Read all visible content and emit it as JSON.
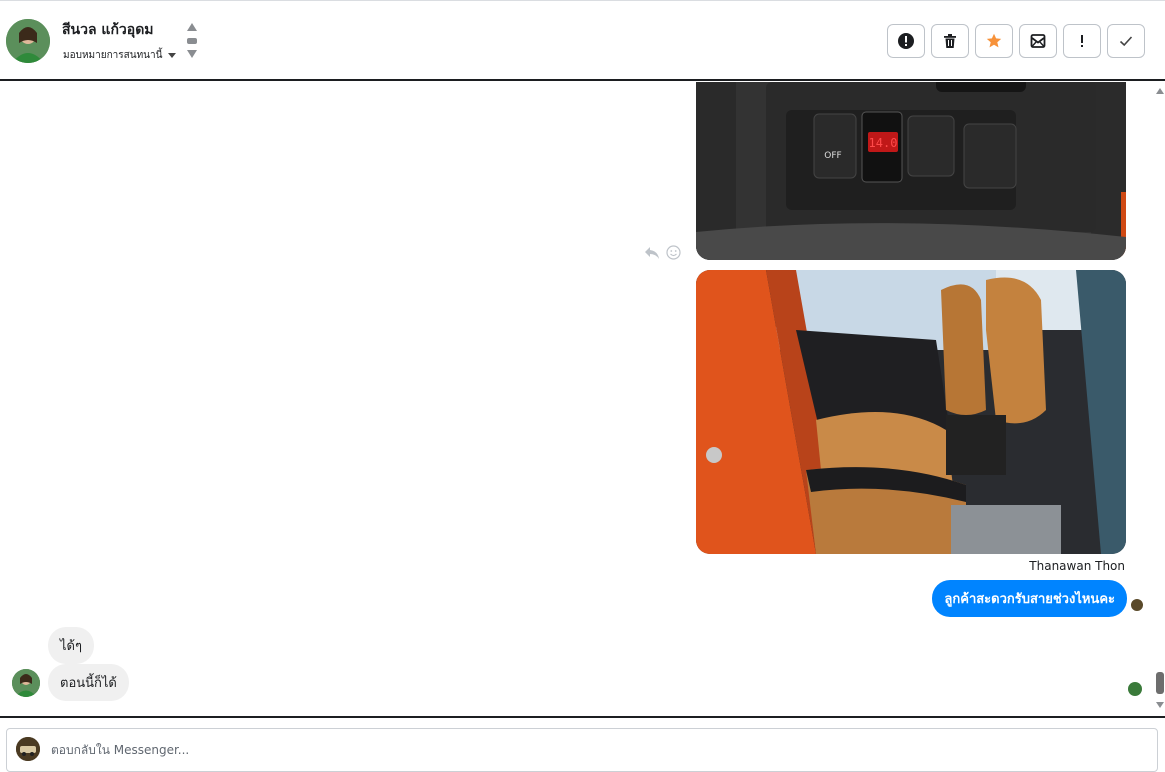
{
  "header": {
    "contact_name": "สีนวล แก้วอุดม",
    "assign_label": "มอบหมายการสนทนานี้",
    "actions": [
      {
        "icon": "alert-circle-icon",
        "label": "Report"
      },
      {
        "icon": "trash-icon",
        "label": "Delete"
      },
      {
        "icon": "star-icon",
        "label": "Star"
      },
      {
        "icon": "mark-unread-icon",
        "label": "Mark unread"
      },
      {
        "icon": "exclamation-icon",
        "label": "Follow up"
      },
      {
        "icon": "check-icon",
        "label": "Done"
      }
    ],
    "accent_star": "#f7923a"
  },
  "conversation": {
    "outgoing": {
      "sender_name": "Thanawan Thon",
      "text": "ลูกค้าสะดวกรับสายช่วงไหนคะ",
      "bubble_color": "#0084ff"
    },
    "incoming": [
      {
        "text": "ได้ๆ"
      },
      {
        "text": "ตอนนี้ก็ได้"
      }
    ]
  },
  "composer": {
    "placeholder": "ตอบกลับใน Messenger..."
  }
}
